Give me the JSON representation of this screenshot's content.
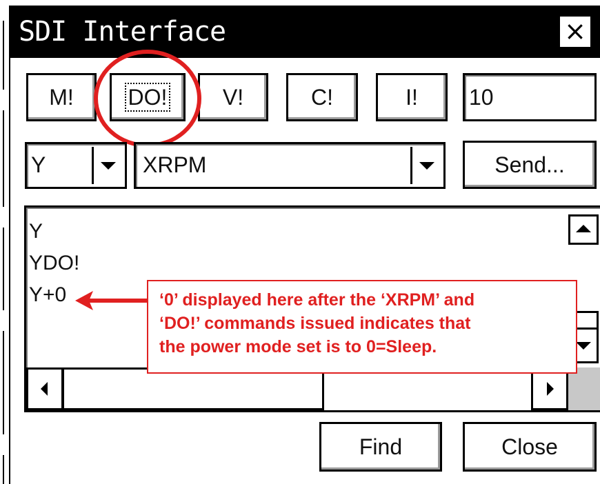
{
  "window": {
    "title": "SDI Interface",
    "close_glyph": "×"
  },
  "commands": [
    {
      "label": "M!"
    },
    {
      "label": "DO!"
    },
    {
      "label": "V!"
    },
    {
      "label": "C!"
    },
    {
      "label": "I!"
    }
  ],
  "count_field": {
    "value": "10"
  },
  "address_select": {
    "value": "Y"
  },
  "command_select": {
    "value": "XRPM"
  },
  "send_label": "Send...",
  "log_lines": [
    "Y",
    "YDO!",
    "Y+0"
  ],
  "annotation": {
    "lines": [
      "‘0’ displayed here after the ‘XRPM’ and",
      "‘DO!’ commands issued indicates that",
      "the power mode set is to 0=Sleep."
    ],
    "color": "#e02020"
  },
  "footer": {
    "find_label": "Find",
    "close_label": "Close"
  }
}
